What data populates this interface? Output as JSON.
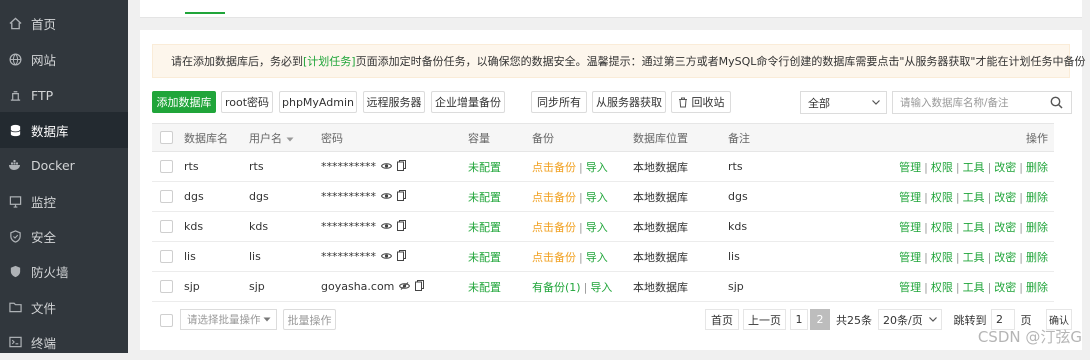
{
  "sidebar": {
    "items": [
      {
        "label": "首页",
        "icon": "home-icon"
      },
      {
        "label": "网站",
        "icon": "globe-icon"
      },
      {
        "label": "FTP",
        "icon": "ftp-icon"
      },
      {
        "label": "数据库",
        "icon": "database-icon",
        "active": true
      },
      {
        "label": "Docker",
        "icon": "docker-icon"
      },
      {
        "label": "监控",
        "icon": "monitor-icon"
      },
      {
        "label": "安全",
        "icon": "shield-icon"
      },
      {
        "label": "防火墙",
        "icon": "firewall-icon"
      },
      {
        "label": "文件",
        "icon": "folder-icon"
      },
      {
        "label": "终端",
        "icon": "terminal-icon"
      }
    ]
  },
  "notice": {
    "prefix": "请在添加数据库后，务必到",
    "link": "[计划任务]",
    "suffix": "页面添加定时备份任务，以确保您的数据安全。温馨提示：通过第三方或者MySQL命令行创建的数据库需要点击\"从服务器获取\"才能在计划任务中备份"
  },
  "toolbar": {
    "add": "添加数据库",
    "root": "root密码",
    "pma": "phpMyAdmin",
    "remote": "远程服务器",
    "incbackup": "企业增量备份",
    "syncall": "同步所有",
    "fetch": "从服务器获取",
    "recycle": "回收站",
    "filter_value": "全部",
    "search_placeholder": "请输入数据库名称/备注"
  },
  "table": {
    "headers": {
      "name": "数据库名",
      "user": "用户名",
      "password": "密码",
      "capacity": "容量",
      "backup": "备份",
      "location": "数据库位置",
      "remark": "备注",
      "ops": "操作"
    },
    "rows": [
      {
        "name": "rts",
        "user": "rts",
        "password": "**********",
        "capacity": "未配置",
        "backup": "点击备份",
        "backup_state": "none",
        "import": "导入",
        "location": "本地数据库",
        "remark": "rts"
      },
      {
        "name": "dgs",
        "user": "dgs",
        "password": "**********",
        "capacity": "未配置",
        "backup": "点击备份",
        "backup_state": "none",
        "import": "导入",
        "location": "本地数据库",
        "remark": "dgs"
      },
      {
        "name": "kds",
        "user": "kds",
        "password": "**********",
        "capacity": "未配置",
        "backup": "点击备份",
        "backup_state": "none",
        "import": "导入",
        "location": "本地数据库",
        "remark": "kds"
      },
      {
        "name": "lis",
        "user": "lis",
        "password": "**********",
        "capacity": "未配置",
        "backup": "点击备份",
        "backup_state": "none",
        "import": "导入",
        "location": "本地数据库",
        "remark": "lis"
      },
      {
        "name": "sjp",
        "user": "sjp",
        "password": "goyasha.com",
        "capacity": "未配置",
        "backup": "有备份(1)",
        "backup_state": "has",
        "import": "导入",
        "location": "本地数据库",
        "remark": "sjp"
      }
    ],
    "ops": [
      "管理",
      "权限",
      "工具",
      "改密",
      "删除"
    ]
  },
  "footer": {
    "batch_placeholder": "请选择批量操作",
    "batch_button": "批量操作"
  },
  "pager": {
    "first": "首页",
    "prev": "上一页",
    "page1": "1",
    "page2": "2",
    "total": "共25条",
    "per_page": "20条/页",
    "jump_label": "跳转到",
    "jump_value": "2",
    "page_unit": "页",
    "confirm": "确认"
  },
  "watermark": "CSDN @汀弦G",
  "colors": {
    "accent": "#20a53a",
    "warning": "#f0a020",
    "sidebar": "#31373d"
  }
}
